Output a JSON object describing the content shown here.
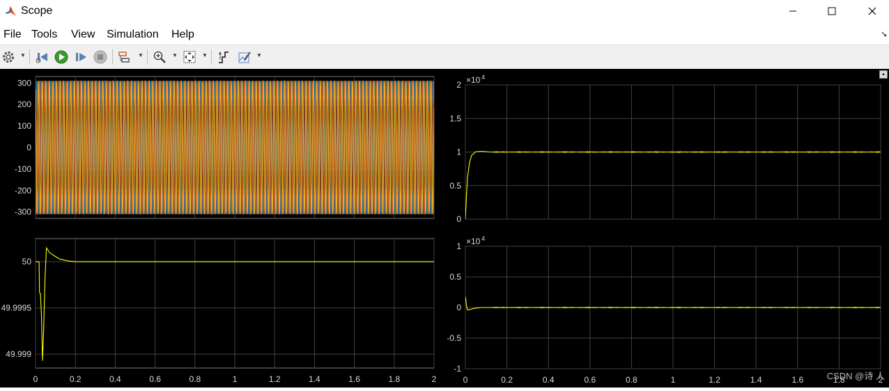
{
  "window": {
    "title": "Scope",
    "minimize": "—",
    "maximize": "☐",
    "close": "✕"
  },
  "menu": [
    "File",
    "Tools",
    "View",
    "Simulation",
    "Help"
  ],
  "toolbar": {
    "buttons": [
      "settings-icon",
      "step-back-icon",
      "run-icon",
      "step-forward-icon",
      "stop-icon",
      "signal-selector-icon",
      "zoom-in-icon",
      "fit-to-view-icon",
      "cursor-measure-icon",
      "style-edit-icon"
    ]
  },
  "watermark": "CSDN @诗 人",
  "colors": {
    "background": "#000000",
    "trace": "#ffff00",
    "grid": "#404040",
    "axis_text": "#d9d9d9"
  },
  "chart_data": [
    {
      "type": "line",
      "panel": "top-left",
      "description_series": [
        "phase-a",
        "phase-b",
        "phase-c"
      ],
      "x_range": [
        0,
        2
      ],
      "ylim": [
        -330,
        330
      ],
      "yticks": [
        300,
        200,
        100,
        0,
        -100,
        -200,
        -300
      ],
      "ytick_labels": [
        "300",
        "200",
        "100",
        "0",
        "-100",
        "-200",
        "-300"
      ],
      "xtick_labels": [],
      "amplitude": 311,
      "frequency_hz": 50,
      "series_colors": [
        "#0072bd",
        "#d95319",
        "#edb120"
      ]
    },
    {
      "type": "line",
      "panel": "bottom-left",
      "x_range": [
        0,
        2
      ],
      "ylim": [
        49.99885,
        50.00025
      ],
      "yticks": [
        50,
        49.9995,
        49.999
      ],
      "ytick_labels": [
        "50",
        "49.9995",
        "49.999"
      ],
      "xticks": [
        0,
        0.2,
        0.4,
        0.6,
        0.8,
        1,
        1.2,
        1.4,
        1.6,
        1.8,
        2
      ],
      "xtick_labels": [
        "0",
        "0.2",
        "0.4",
        "0.6",
        "0.8",
        "1",
        "1.2",
        "1.4",
        "1.6",
        "1.8",
        "2"
      ],
      "points": [
        [
          0,
          50
        ],
        [
          0.018,
          50
        ],
        [
          0.02,
          49.99967
        ],
        [
          0.025,
          49.99965
        ],
        [
          0.03,
          49.9994
        ],
        [
          0.035,
          49.99893
        ],
        [
          0.04,
          49.9992
        ],
        [
          0.048,
          49.99985
        ],
        [
          0.055,
          50.00015
        ],
        [
          0.07,
          50.0001
        ],
        [
          0.09,
          50.00007
        ],
        [
          0.12,
          50.00003
        ],
        [
          0.16,
          50.00001
        ],
        [
          0.2,
          50
        ],
        [
          2,
          50
        ]
      ]
    },
    {
      "type": "line",
      "panel": "top-right",
      "x_range": [
        0,
        2
      ],
      "ylim": [
        0,
        20000
      ],
      "exponent_label": "×10",
      "exponent": "4",
      "yticks": [
        20000,
        15000,
        10000,
        5000,
        0
      ],
      "ytick_labels": [
        "2",
        "1.5",
        "1",
        "0.5",
        "0"
      ],
      "xticks": [
        0,
        0.2,
        0.4,
        0.6,
        0.8,
        1,
        1.2,
        1.4,
        1.6,
        1.8,
        2
      ],
      "xtick_labels": [],
      "points": [
        [
          0,
          0
        ],
        [
          0.005,
          3500
        ],
        [
          0.01,
          6200
        ],
        [
          0.02,
          8500
        ],
        [
          0.03,
          9500
        ],
        [
          0.05,
          10050
        ],
        [
          0.08,
          10100
        ],
        [
          0.12,
          10000
        ],
        [
          2,
          10000
        ]
      ]
    },
    {
      "type": "line",
      "panel": "bottom-right",
      "x_range": [
        0,
        2
      ],
      "ylim": [
        -10000,
        10000
      ],
      "exponent_label": "×10",
      "exponent": "4",
      "yticks": [
        10000,
        5000,
        0,
        -5000,
        -10000
      ],
      "ytick_labels": [
        "1",
        "0.5",
        "0",
        "-0.5",
        "-1"
      ],
      "xticks": [
        0,
        0.2,
        0.4,
        0.6,
        0.8,
        1,
        1.2,
        1.4,
        1.6,
        1.8,
        2
      ],
      "xtick_labels": [
        "0",
        "0.2",
        "0.4",
        "0.6",
        "0.8",
        "1",
        "1.2",
        "1.4",
        "1.6",
        "1.8",
        "2"
      ],
      "points": [
        [
          0,
          1800
        ],
        [
          0.005,
          300
        ],
        [
          0.01,
          -400
        ],
        [
          0.02,
          -350
        ],
        [
          0.04,
          -150
        ],
        [
          0.08,
          0
        ],
        [
          2,
          0
        ]
      ]
    }
  ]
}
